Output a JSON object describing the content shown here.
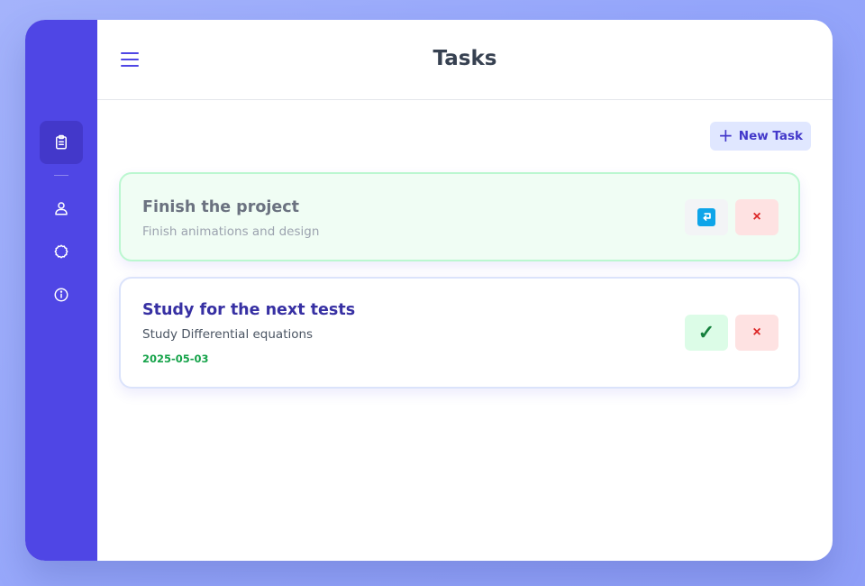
{
  "header": {
    "title": "Tasks"
  },
  "sidebar": {
    "items": [
      {
        "icon": "clipboard-icon",
        "active": true
      },
      {
        "icon": "user-icon",
        "active": false
      },
      {
        "icon": "settings-icon",
        "active": false
      },
      {
        "icon": "info-icon",
        "active": false
      }
    ]
  },
  "toolbar": {
    "new_task_label": "New Task",
    "new_task_icon": "plus-icon"
  },
  "tasks": [
    {
      "title": "Finish the project",
      "description": "Finish animations and design",
      "status": "completed",
      "actions": [
        "undo-icon",
        "delete-icon"
      ],
      "delete_symbol": "×"
    },
    {
      "title": "Study for the next tests",
      "description": "Study Differential equations",
      "date": "2025-05-03",
      "status": "pending",
      "actions": [
        "check-icon",
        "delete-icon"
      ],
      "check_symbol": "✓",
      "delete_symbol": "×"
    }
  ],
  "colors": {
    "sidebar": "#4f46e5",
    "sidebar_active": "#4338ca",
    "accent": "#4338ca",
    "completed_bg": "#f0fdf4",
    "completed_border": "#bbf7d0",
    "date": "#16a34a",
    "delete": "#dc2626",
    "undo": "#0ea5e9"
  }
}
